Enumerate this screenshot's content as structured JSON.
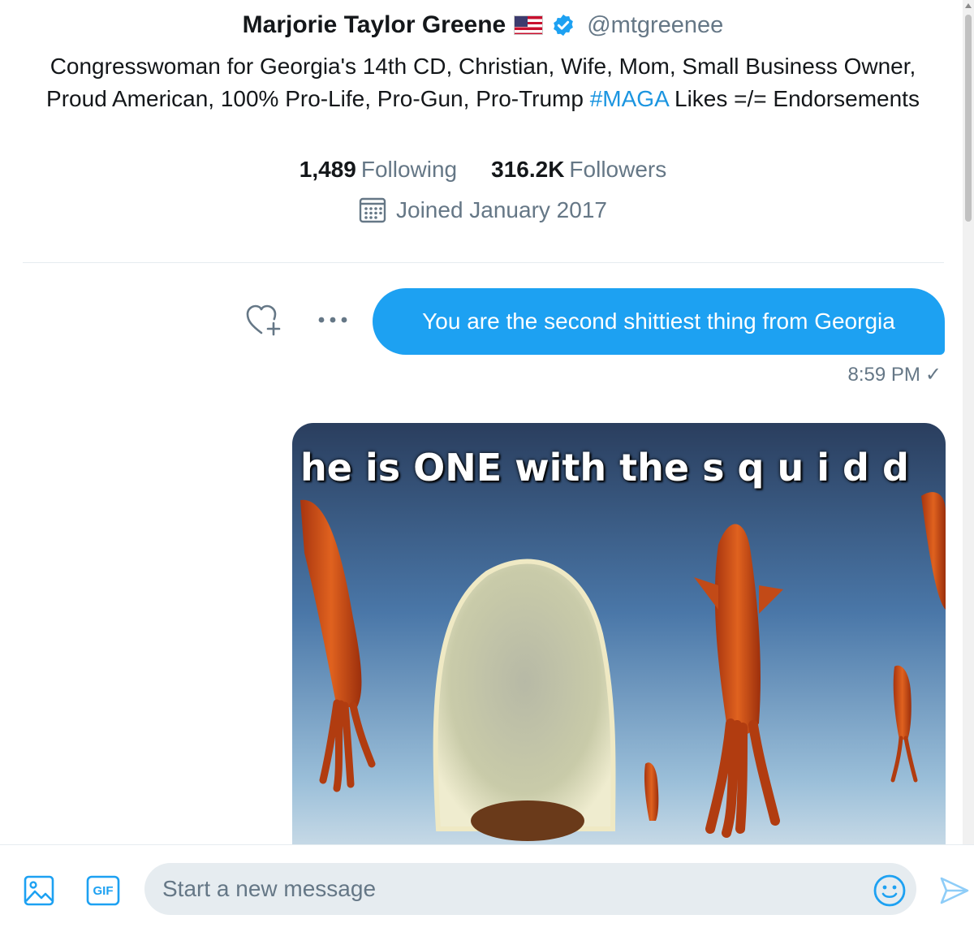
{
  "profile": {
    "name": "Marjorie Taylor Greene",
    "handle": "@mtgreenee",
    "bio_before": "Congresswoman for Georgia's 14th CD, Christian, Wife, Mom, Small Business Owner, Proud American, 100% Pro-Life, Pro-Gun, Pro-Trump ",
    "bio_hashtag": "#MAGA",
    "bio_after": " Likes =/= Endorsements",
    "following_count": "1,489",
    "following_label": "Following",
    "followers_count": "316.2K",
    "followers_label": "Followers",
    "joined": "Joined January 2017"
  },
  "message": {
    "text": "You are the second shittiest thing from Georgia",
    "time": "8:59 PM",
    "read_mark": "✓"
  },
  "media": {
    "caption": "he is ONE with the  s q u i d d"
  },
  "composer": {
    "placeholder": "Start a new message",
    "gif_label": "GIF"
  },
  "colors": {
    "accent": "#1da1f2",
    "link": "#1b95e0",
    "secondary_text": "#657786"
  },
  "icons": [
    "flag-us-icon",
    "verified-icon",
    "calendar-icon",
    "heart-plus-icon",
    "more-icon",
    "image-icon",
    "gif-icon",
    "emoji-icon",
    "send-icon"
  ]
}
